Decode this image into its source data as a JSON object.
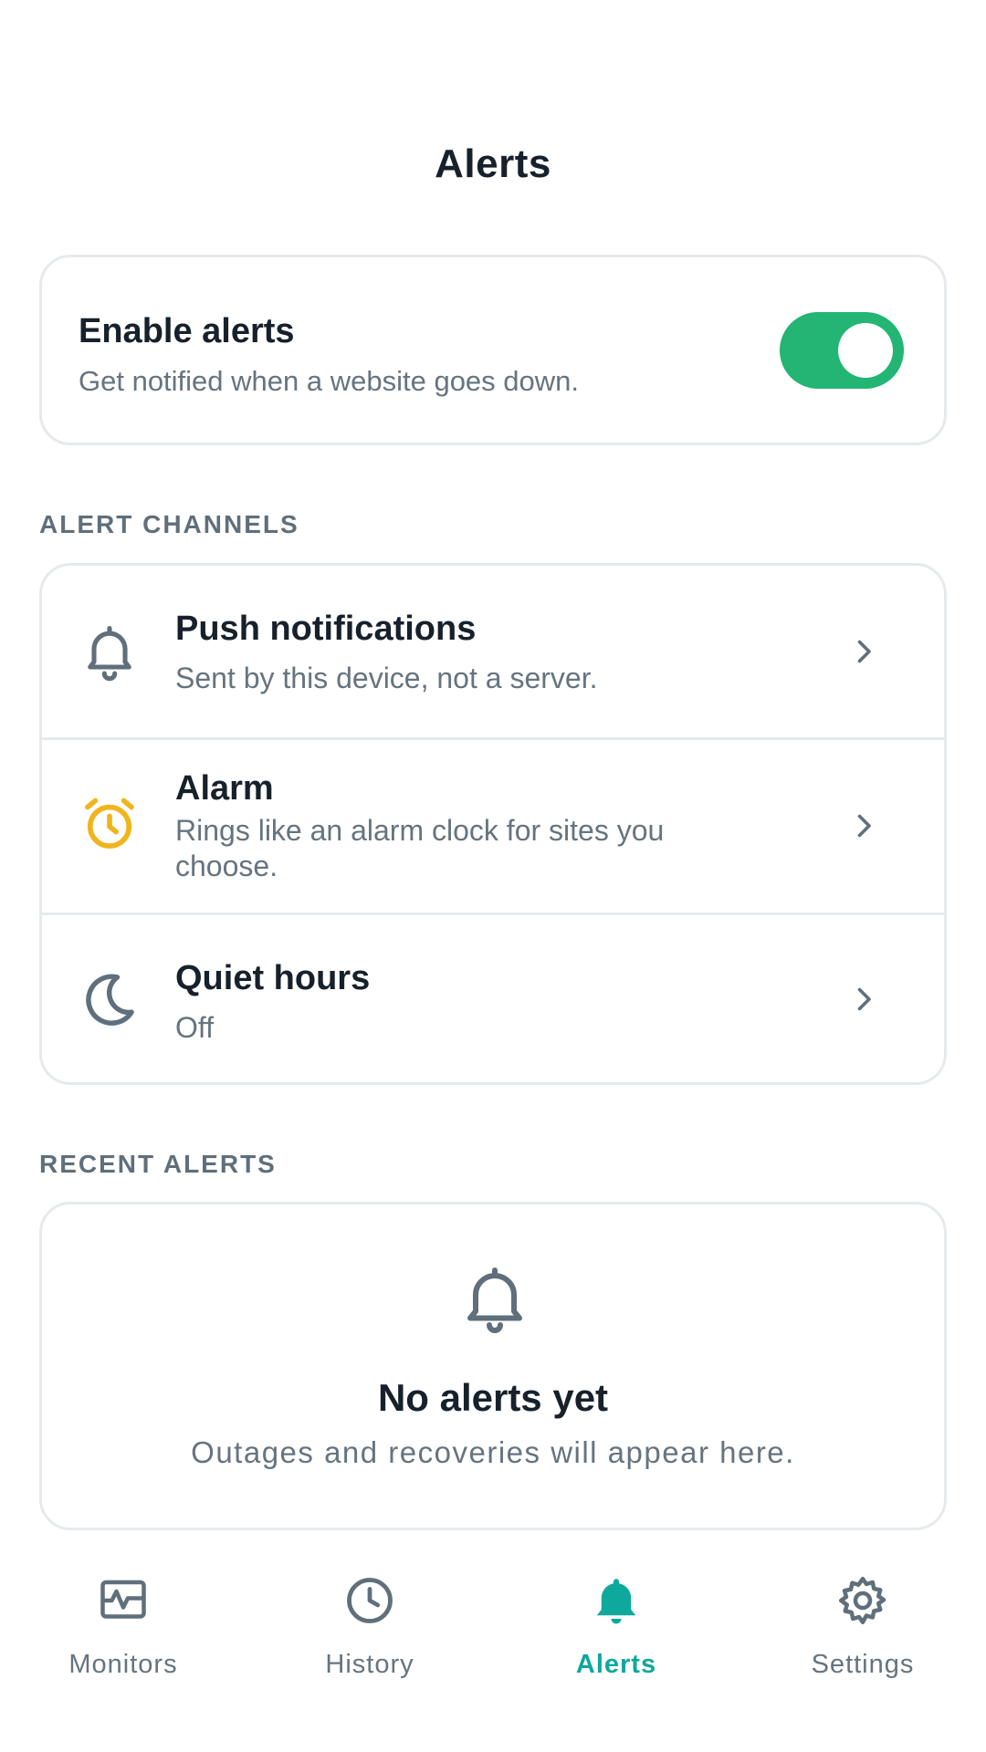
{
  "header": {
    "title": "Alerts"
  },
  "enable": {
    "title": "Enable alerts",
    "subtitle": "Get notified when a website goes down.",
    "toggle_on": true
  },
  "channels": {
    "section_label": "ALERT CHANNELS",
    "items": [
      {
        "icon": "bell-icon",
        "title": "Push notifications",
        "subtitle": "Sent by this device, not a server."
      },
      {
        "icon": "alarm-clock-icon",
        "title": "Alarm",
        "subtitle": "Rings like an alarm clock for sites you choose."
      },
      {
        "icon": "moon-icon",
        "title": "Quiet hours",
        "subtitle": "Off"
      }
    ]
  },
  "recent": {
    "section_label": "RECENT ALERTS",
    "empty_title": "No alerts yet",
    "empty_subtitle": "Outages and recoveries will appear here."
  },
  "nav": {
    "items": [
      {
        "icon": "monitor-pulse-icon",
        "label": "Monitors",
        "active": false
      },
      {
        "icon": "clock-icon",
        "label": "History",
        "active": false
      },
      {
        "icon": "bell-icon",
        "label": "Alerts",
        "active": true
      },
      {
        "icon": "gear-icon",
        "label": "Settings",
        "active": false
      }
    ]
  },
  "colors": {
    "accent": "#0fa89c",
    "toggle_on": "#22b573",
    "alarm_icon": "#f0b41c",
    "text_primary": "#17212b",
    "text_secondary": "#66747f",
    "border": "#e6eaed"
  }
}
